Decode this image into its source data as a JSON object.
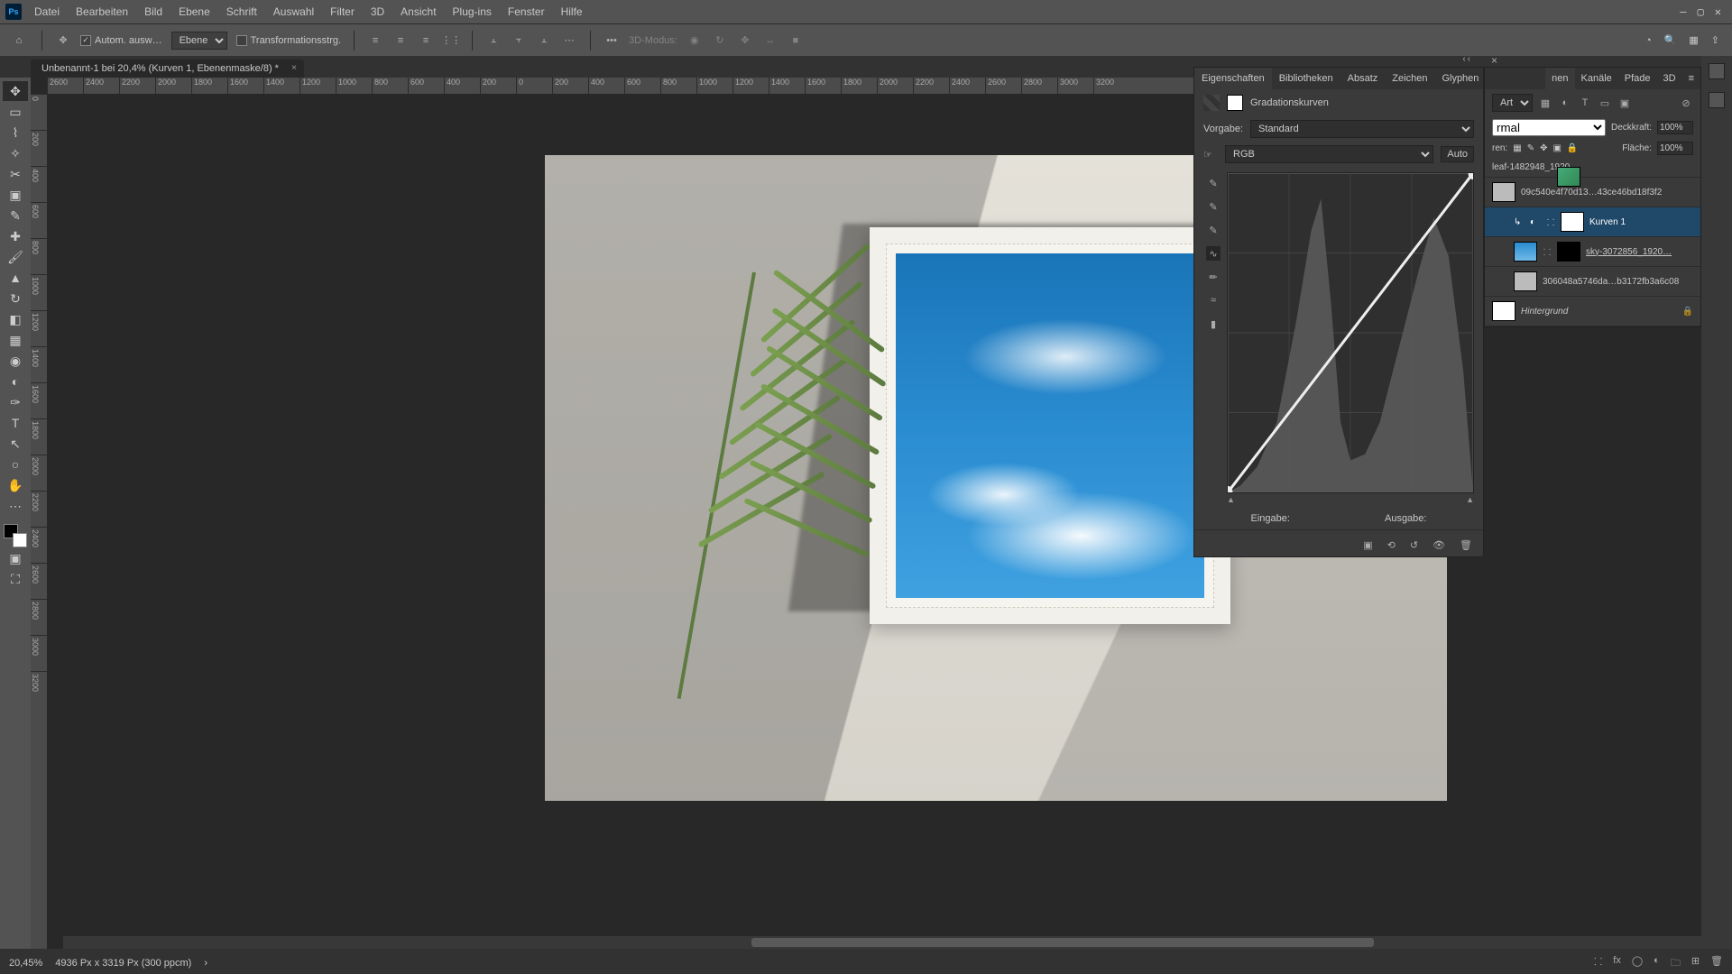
{
  "menu": {
    "items": [
      "Datei",
      "Bearbeiten",
      "Bild",
      "Ebene",
      "Schrift",
      "Auswahl",
      "Filter",
      "3D",
      "Ansicht",
      "Plug-ins",
      "Fenster",
      "Hilfe"
    ]
  },
  "window_controls": {
    "min": "—",
    "max": "▢",
    "close": "✕"
  },
  "options": {
    "auto_select_label": "Autom. ausw…",
    "target_label": "Ebene",
    "transform_label": "Transformationsstrg.",
    "mode_3d_label": "3D-Modus:"
  },
  "doc_tab": {
    "title": "Unbenannt-1 bei 20,4% (Kurven 1, Ebenenmaske/8) *"
  },
  "ruler_h": [
    "2600",
    "2400",
    "2200",
    "2000",
    "1800",
    "1600",
    "1400",
    "1200",
    "1000",
    "800",
    "600",
    "400",
    "200",
    "0",
    "200",
    "400",
    "600",
    "800",
    "1000",
    "1200",
    "1400",
    "1600",
    "1800",
    "2000",
    "2200",
    "2400",
    "2600",
    "2800",
    "3000",
    "3200"
  ],
  "ruler_v": [
    "0",
    "200",
    "400",
    "600",
    "800",
    "1000",
    "1200",
    "1400",
    "1600",
    "1800",
    "2000",
    "2200",
    "2400",
    "2600",
    "2800",
    "3000",
    "3200"
  ],
  "properties": {
    "tabs": [
      "Eigenschaften",
      "Bibliotheken",
      "Absatz",
      "Zeichen",
      "Glyphen"
    ],
    "title": "Gradationskurven",
    "preset_label": "Vorgabe:",
    "preset_value": "Standard",
    "channel_value": "RGB",
    "auto_label": "Auto",
    "input_label": "Eingabe:",
    "output_label": "Ausgabe:"
  },
  "layers_panel": {
    "tabs": [
      "nen",
      "Kanäle",
      "Pfade",
      "3D"
    ],
    "kind_value": "Art",
    "blend_value": "rmal",
    "opacity_label": "Deckkraft:",
    "opacity_value": "100%",
    "lock_label": "ren:",
    "fill_label": "Fläche:",
    "fill_value": "100%",
    "layers": [
      {
        "name": "leaf-1482948_1920",
        "thumb": "leaf"
      },
      {
        "name": "09c540e4f70d13…43ce46bd18f3f2",
        "thumb": "room"
      },
      {
        "name": "Kurven 1",
        "thumb": "adj",
        "selected": true,
        "indent": true
      },
      {
        "name": "sky-3072856_1920…",
        "thumb": "sky",
        "underline": true,
        "mask": "black",
        "indent": true
      },
      {
        "name": "306048a5746da…b3172fb3a6c08",
        "thumb": "room",
        "indent": true
      },
      {
        "name": "Hintergrund",
        "thumb": "white",
        "italic": true,
        "locked": true
      }
    ]
  },
  "status": {
    "zoom": "20,45%",
    "info": "4936 Px x 3319 Px (300 ppcm)"
  }
}
